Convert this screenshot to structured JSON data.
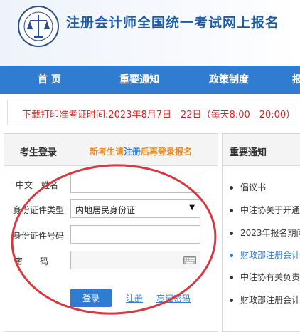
{
  "header": {
    "title": "注册会计师全国统一考试网上报名"
  },
  "nav": {
    "items": [
      "首 页",
      "重要通知",
      "政策制度",
      "报"
    ]
  },
  "notice": {
    "text": "下载打印准考证时间:2023年8月7日—22日（每天8:00—20:00）"
  },
  "login": {
    "title": "考生登录",
    "hint_prefix": "新考生请",
    "hint_link": "注册",
    "hint_suffix": "后再登录报名",
    "fields": {
      "name_label": "中文　姓名",
      "id_type_label": "身份证件类型",
      "id_type_value": "内地居民身份证",
      "id_number_label": "身份证件号码",
      "password_label": "密　　码"
    },
    "login_button": "登录",
    "register_link": "注册",
    "forgot_link": "忘记密码"
  },
  "news": {
    "title": "重要通知",
    "items": [
      {
        "text": "倡议书"
      },
      {
        "text": "中注协关于开通"
      },
      {
        "text": "2023年报名期间"
      },
      {
        "text": "财政部注册会计"
      },
      {
        "text": "中注协有关负责"
      },
      {
        "text": "财政部注册会计"
      }
    ]
  },
  "colors": {
    "brand_blue": "#2f7cd0",
    "notice_red": "#e02020",
    "hint_orange": "#ea8a1a",
    "annotation_red": "#d9363e"
  },
  "icons": {
    "logo": "cicpa-emblem-logo",
    "keyboard": "keyboard-icon",
    "select": "chevron-down-icon"
  }
}
